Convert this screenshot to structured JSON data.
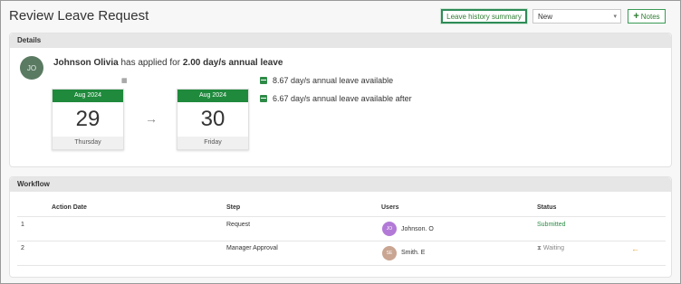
{
  "header": {
    "title": "Review Leave Request",
    "history_button": "Leave history summary",
    "status_value": "New",
    "notes_button": "Notes"
  },
  "details": {
    "section_title": "Details",
    "avatar_initials": "JO",
    "applicant_name": "Johnson Olivia",
    "applied_text": "has applied for",
    "amount_text": "2.00 day/s annual leave",
    "from": {
      "month": "Aug 2024",
      "day": "29",
      "weekday": "Thursday"
    },
    "to": {
      "month": "Aug 2024",
      "day": "30",
      "weekday": "Friday"
    },
    "available": "8.67 day/s annual leave available",
    "available_after": "6.67 day/s annual leave available after"
  },
  "workflow": {
    "section_title": "Workflow",
    "columns": [
      "Action Date",
      "Step",
      "Users",
      "Status"
    ],
    "rows": [
      {
        "num": "1",
        "step": "Request",
        "user_initials": "JO",
        "user": "Johnson. O",
        "status": "Submitted"
      },
      {
        "num": "2",
        "step": "Manager Approval",
        "user_initials": "SE",
        "user": "Smith. E",
        "status": "Waiting"
      }
    ]
  },
  "icons": {
    "calendar": "calendar-icon",
    "arrow": "arrow-right-icon",
    "waiting": "hourglass-icon",
    "current_step": "arrow-left-icon",
    "add": "plus-icon"
  },
  "colors": {
    "accent_green": "#1f8a3c",
    "submitted": "#2e8b47",
    "current_step_marker": "#e6a623"
  }
}
